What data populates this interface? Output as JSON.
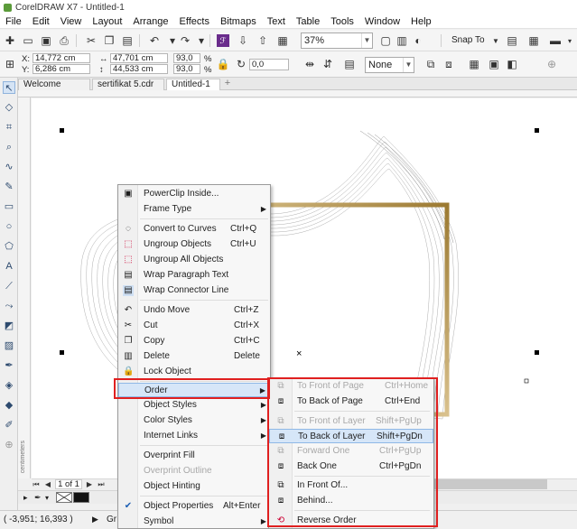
{
  "window": {
    "title": "CorelDRAW X7 - Untitled-1"
  },
  "menu": [
    "File",
    "Edit",
    "View",
    "Layout",
    "Arrange",
    "Effects",
    "Bitmaps",
    "Text",
    "Table",
    "Tools",
    "Window",
    "Help"
  ],
  "toolbar": {
    "zoom": "37%",
    "snap_label": "Snap To"
  },
  "propertybar": {
    "x_label": "X:",
    "x_value": "14,772 cm",
    "y_label": "Y:",
    "y_value": "6,286 cm",
    "w_value": "47,701 cm",
    "h_value": "44,533 cm",
    "scale_x": "93,0",
    "scale_y": "93,0",
    "percent": "%",
    "rotation": "0,0",
    "outline": "None"
  },
  "tabs": [
    "Welcome Screen",
    "sertifikat 5.cdr",
    "Untitled-1"
  ],
  "ruler_units": "centimeters",
  "page_controls": {
    "page": "1 of 1"
  },
  "status": {
    "coords": "( -3,951; 16,393 )",
    "partial": "Gr"
  },
  "context_menu": {
    "items": [
      {
        "label": "PowerClip Inside...",
        "icon": "powerclip-icon"
      },
      {
        "label": "Frame Type",
        "submenu": true
      },
      {
        "label": "Convert to Curves",
        "shortcut": "Ctrl+Q",
        "icon": "curves-icon"
      },
      {
        "label": "Ungroup Objects",
        "shortcut": "Ctrl+U",
        "icon": "ungroup-icon"
      },
      {
        "label": "Ungroup All Objects",
        "icon": "ungroup-all-icon"
      },
      {
        "label": "Wrap Paragraph Text",
        "icon": "wrap-text-icon"
      },
      {
        "label": "Wrap Connector Line",
        "icon": "wrap-connector-icon"
      },
      {
        "label": "Undo Move",
        "shortcut": "Ctrl+Z",
        "icon": "undo-icon"
      },
      {
        "label": "Cut",
        "shortcut": "Ctrl+X",
        "icon": "cut-icon"
      },
      {
        "label": "Copy",
        "shortcut": "Ctrl+C",
        "icon": "copy-icon"
      },
      {
        "label": "Delete",
        "shortcut": "Delete",
        "icon": "delete-icon"
      },
      {
        "label": "Lock Object",
        "icon": "lock-icon"
      },
      {
        "label": "Order",
        "submenu": true,
        "highlighted": true
      },
      {
        "label": "Object Styles",
        "submenu": true
      },
      {
        "label": "Color Styles",
        "submenu": true
      },
      {
        "label": "Internet Links",
        "submenu": true
      },
      {
        "label": "Overprint Fill"
      },
      {
        "label": "Overprint Outline",
        "disabled": true
      },
      {
        "label": "Object Hinting"
      },
      {
        "label": "Object Properties",
        "shortcut": "Alt+Enter",
        "checked": true
      },
      {
        "label": "Symbol",
        "submenu": true
      }
    ]
  },
  "order_submenu": {
    "items": [
      {
        "label": "To Front of Page",
        "shortcut": "Ctrl+Home",
        "disabled": true
      },
      {
        "label": "To Back of Page",
        "shortcut": "Ctrl+End"
      },
      {
        "label": "To Front of Layer",
        "shortcut": "Shift+PgUp",
        "disabled": true
      },
      {
        "label": "To Back of Layer",
        "shortcut": "Shift+PgDn",
        "highlighted": true
      },
      {
        "label": "Forward One",
        "shortcut": "Ctrl+PgUp",
        "disabled": true
      },
      {
        "label": "Back One",
        "shortcut": "Ctrl+PgDn"
      },
      {
        "label": "In Front Of..."
      },
      {
        "label": "Behind..."
      },
      {
        "label": "Reverse Order"
      }
    ]
  },
  "colors": {
    "highlight": "#d6e6f8",
    "annotation_red": "#e02020",
    "gold_frame": "#b8860b"
  }
}
